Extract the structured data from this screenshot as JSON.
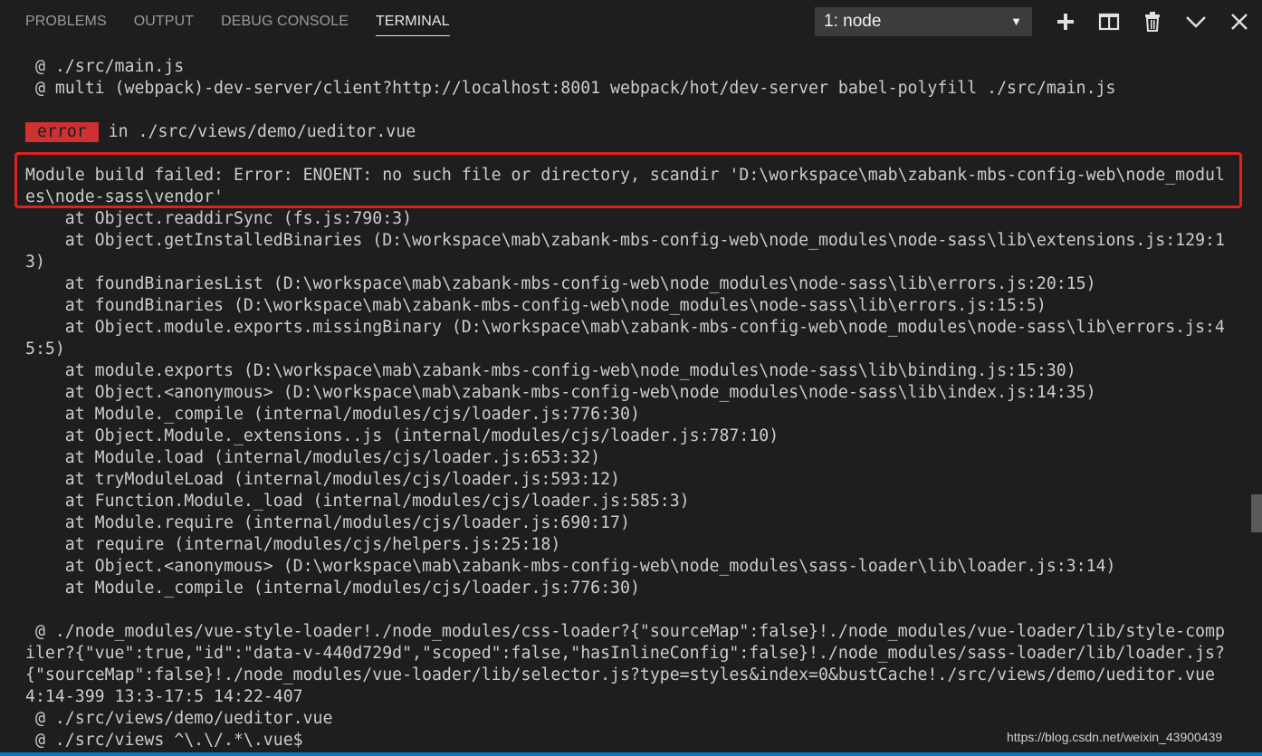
{
  "panel": {
    "tabs": [
      "PROBLEMS",
      "OUTPUT",
      "DEBUG CONSOLE",
      "TERMINAL"
    ],
    "active_tab": "TERMINAL",
    "terminal_select": {
      "value": "1: node",
      "arrow": "▼"
    },
    "toolbar_icons": [
      "plus-icon",
      "split-icon",
      "trash-icon",
      "chevron-down-icon",
      "close-icon"
    ]
  },
  "terminal": {
    "lines": [
      " @ ./src/main.js",
      " @ multi (webpack)-dev-server/client?http://localhost:8001 webpack/hot/dev-server babel-polyfill ./src/main.js",
      "",
      " in ./src/views/demo/ueditor.vue",
      "",
      "Module build failed: Error: ENOENT: no such file or directory, scandir 'D:\\workspace\\mab\\zabank-mbs-config-web\\node_modul",
      "es\\node-sass\\vendor'",
      "    at Object.readdirSync (fs.js:790:3)",
      "    at Object.getInstalledBinaries (D:\\workspace\\mab\\zabank-mbs-config-web\\node_modules\\node-sass\\lib\\extensions.js:129:1",
      "3)",
      "    at foundBinariesList (D:\\workspace\\mab\\zabank-mbs-config-web\\node_modules\\node-sass\\lib\\errors.js:20:15)",
      "    at foundBinaries (D:\\workspace\\mab\\zabank-mbs-config-web\\node_modules\\node-sass\\lib\\errors.js:15:5)",
      "    at Object.module.exports.missingBinary (D:\\workspace\\mab\\zabank-mbs-config-web\\node_modules\\node-sass\\lib\\errors.js:4",
      "5:5)",
      "    at module.exports (D:\\workspace\\mab\\zabank-mbs-config-web\\node_modules\\node-sass\\lib\\binding.js:15:30)",
      "    at Object.<anonymous> (D:\\workspace\\mab\\zabank-mbs-config-web\\node_modules\\node-sass\\lib\\index.js:14:35)",
      "    at Module._compile (internal/modules/cjs/loader.js:776:30)",
      "    at Object.Module._extensions..js (internal/modules/cjs/loader.js:787:10)",
      "    at Module.load (internal/modules/cjs/loader.js:653:32)",
      "    at tryModuleLoad (internal/modules/cjs/loader.js:593:12)",
      "    at Function.Module._load (internal/modules/cjs/loader.js:585:3)",
      "    at Module.require (internal/modules/cjs/loader.js:690:17)",
      "    at require (internal/modules/cjs/helpers.js:25:18)",
      "    at Object.<anonymous> (D:\\workspace\\mab\\zabank-mbs-config-web\\node_modules\\sass-loader\\lib\\loader.js:3:14)",
      "    at Module._compile (internal/modules/cjs/loader.js:776:30)",
      "",
      " @ ./node_modules/vue-style-loader!./node_modules/css-loader?{\"sourceMap\":false}!./node_modules/vue-loader/lib/style-comp",
      "iler?{\"vue\":true,\"id\":\"data-v-440d729d\",\"scoped\":false,\"hasInlineConfig\":false}!./node_modules/sass-loader/lib/loader.js?",
      "{\"sourceMap\":false}!./node_modules/vue-loader/lib/selector.js?type=styles&index=0&bustCache!./src/views/demo/ueditor.vue",
      "4:14-399 13:3-17:5 14:22-407",
      " @ ./src/views/demo/ueditor.vue",
      " @ ./src/views ^\\.\\/.*\\.vue$"
    ],
    "error_badge": "error",
    "error_badge_line": 3
  },
  "watermark": "https://blog.csdn.net/weixin_43900439",
  "colors": {
    "background": "#1e1e1e",
    "foreground": "#cccccc",
    "error_badge": "#cd3131",
    "highlight_border": "#e02020",
    "status_bar": "#007acc"
  }
}
